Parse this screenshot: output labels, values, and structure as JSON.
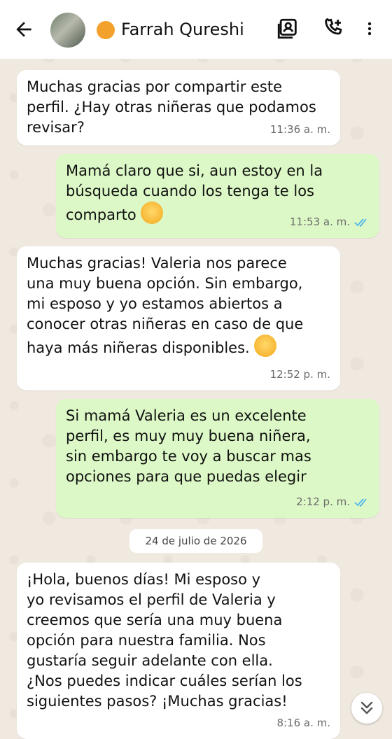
{
  "header": {
    "contact_name": "Farrah Qureshi"
  },
  "messages": [
    {
      "direction": "in",
      "text": "Muchas gracias por compartir este\nperfil. ¿Hay otras niñeras que podamos\nrevisar?",
      "time": "11:36 a. m."
    },
    {
      "direction": "out",
      "text": "Mamá claro que si, aun estoy en la\nbúsqueda cuando los tenga te los\ncomparto",
      "emoji": "hugging-face",
      "time": "11:53 a. m.",
      "read": true
    },
    {
      "direction": "in",
      "text": "Muchas gracias! Valeria nos parece\nuna muy buena opción. Sin embargo,\nmi esposo y yo estamos abiertos a\nconocer otras niñeras en caso de que\nhaya más niñeras disponibles.",
      "emoji": "smiling-face",
      "time": "12:52 p. m."
    },
    {
      "direction": "out",
      "text": "Si mamá Valeria es un excelente\nperfil, es muy muy buena niñera,\nsin embargo te voy a buscar mas\nopciones para que puedas elegir",
      "time": "2:12 p. m.",
      "read": true
    },
    {
      "direction": "in",
      "text": "¡Hola, buenos días! Mi esposo y\nyo revisamos el perfil de Valeria y\ncreemos que sería una muy buena\nopción para nuestra familia. Nos\ngustaría seguir adelante con ella.\n¿Nos puedes indicar cuáles serían los\nsiguientes pasos? ¡Muchas gracias!",
      "time": "8:16 a. m."
    }
  ],
  "date_separator": "24 de julio de 2026",
  "colors": {
    "incoming": "#ffffff",
    "outgoing": "#dcf8c6",
    "read_ticks": "#4fb6ec",
    "status_dot": "#f2a12d"
  },
  "icons": [
    "back-arrow-icon",
    "contact-card-icon",
    "add-call-icon",
    "more-vert-icon",
    "chevron-double-down-icon",
    "double-check-icon"
  ]
}
